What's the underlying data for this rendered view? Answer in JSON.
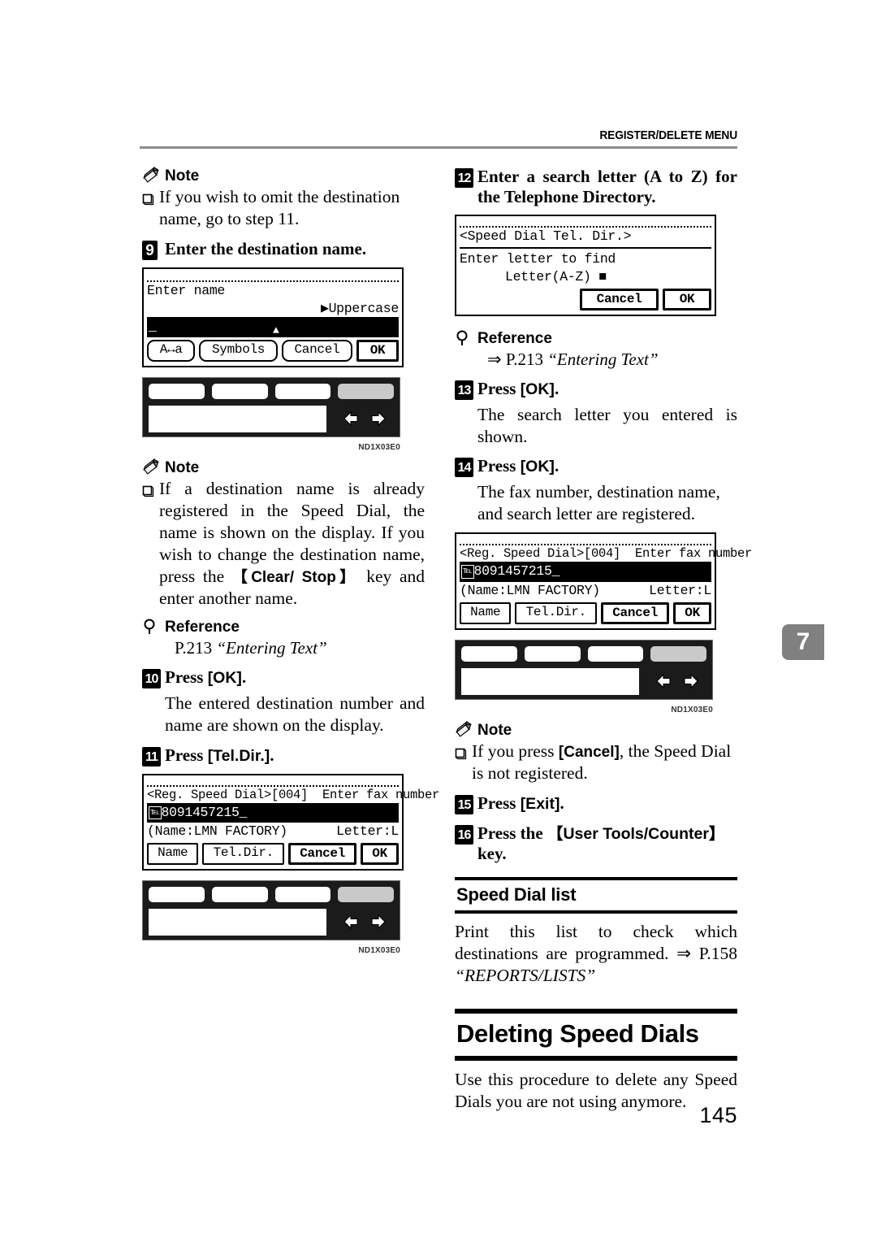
{
  "header": {
    "running_head": "REGISTER/DELETE MENU"
  },
  "chapter_tab": "7",
  "page_number": "145",
  "labels": {
    "note": "Note",
    "reference": "Reference",
    "checkbox_glyph": "❏",
    "arrow_glyph": "⇒"
  },
  "left_column": {
    "note1": {
      "heading": "Note",
      "items": [
        "If you wish to omit the destination name, go to step 11."
      ]
    },
    "step9": {
      "number": "9",
      "text": "Enter the destination name."
    },
    "lcd_enter_name": {
      "line1": "Enter name",
      "line2": "▶Uppercase",
      "input_value": "_",
      "buttons": [
        "A↔a",
        "Symbols",
        "Cancel",
        "OK"
      ]
    },
    "control_panel_1": {
      "figure_id": "ND1X03E0",
      "left_arrow": "left-arrow",
      "right_arrow": "right-arrow"
    },
    "note2": {
      "heading": "Note",
      "items_html": [
        "If a destination name is already registered in the Speed Dial, the name is shown on the display. If you wish to change the destination name, press the 【Clear/ Stop】 key and enter another name."
      ],
      "item_pre": "If a destination name is already registered in the Speed Dial, the name is shown on the display. If you wish to change the destination name, press the ",
      "item_key": "【Clear/ Stop】",
      "item_post": " key and enter another name."
    },
    "reference1": {
      "heading": "Reference",
      "page": "P.213",
      "title": "“Entering Text”"
    },
    "step10": {
      "number": "10",
      "text_pre": "Press ",
      "key": "[OK]",
      "text_post": ".",
      "body": "The entered destination number and name are shown on the display."
    },
    "step11": {
      "number": "11",
      "text_pre": "Press ",
      "key": "[Tel.Dir.]",
      "text_post": "."
    },
    "lcd_reg_speed_dial": {
      "title": "<Reg. Speed Dial>[004]  Enter fax number",
      "fax_icon": "fax-icon",
      "number": "8091457215_",
      "name": "(Name:LMN FACTORY)",
      "letter": "Letter:L",
      "buttons": [
        "Name",
        "Tel.Dir.",
        "Cancel",
        "OK"
      ]
    },
    "control_panel_2": {
      "figure_id": "ND1X03E0"
    }
  },
  "right_column": {
    "step12": {
      "number": "12",
      "text": "Enter a search letter (A to Z) for the Telephone Directory."
    },
    "lcd_tel_dir": {
      "title": "<Speed Dial Tel. Dir.>",
      "line1": "Enter letter to find",
      "line2": "Letter(A-Z) ",
      "cursor": "■",
      "buttons": [
        "Cancel",
        "OK"
      ]
    },
    "reference2": {
      "heading": "Reference",
      "arrow": "⇒",
      "page": "P.213",
      "title": "“Entering Text”"
    },
    "step13": {
      "number": "13",
      "text_pre": "Press ",
      "key": "[OK]",
      "text_post": ".",
      "body": "The search letter you entered is shown."
    },
    "step14": {
      "number": "14",
      "text_pre": "Press ",
      "key": "[OK]",
      "text_post": ".",
      "body": "The fax number, destination name, and search letter are registered."
    },
    "lcd_reg_speed_dial2": {
      "title": "<Reg. Speed Dial>[004]  Enter fax number",
      "number": "8091457215_",
      "name": "(Name:LMN FACTORY)",
      "letter": "Letter:L",
      "buttons": [
        "Name",
        "Tel.Dir.",
        "Cancel",
        "OK"
      ]
    },
    "control_panel_3": {
      "figure_id": "ND1X03E0"
    },
    "note3": {
      "heading": "Note",
      "item_pre": "If you press ",
      "item_key": "[Cancel]",
      "item_post": ", the Speed Dial is not registered."
    },
    "step15": {
      "number": "15",
      "text_pre": "Press ",
      "key": "[Exit]",
      "text_post": "."
    },
    "step16": {
      "number": "16",
      "text_pre": "Press the ",
      "key": "【User Tools/Counter】",
      "text_post": " key."
    },
    "section_speed_dial_list": {
      "heading": "Speed Dial list",
      "body_pre": "Print this list to check which destinations are programmed. ",
      "arrow": "⇒",
      "body_page": " P.158 ",
      "body_title": "“REPORTS/LISTS”"
    },
    "section_deleting": {
      "heading": "Deleting Speed Dials",
      "body": "Use this procedure to delete any Speed Dials you are not using anymore."
    }
  }
}
